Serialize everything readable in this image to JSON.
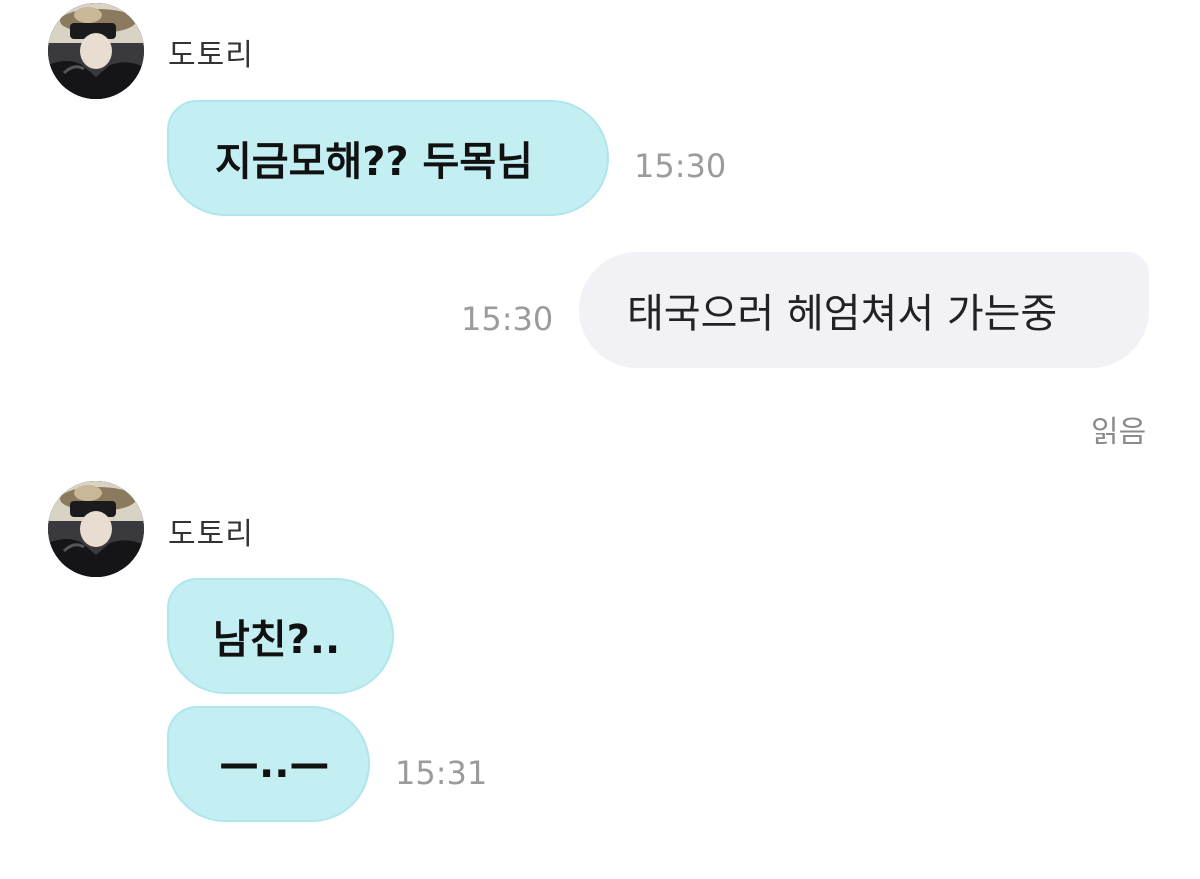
{
  "chat": {
    "group1": {
      "sender_name": "도토리",
      "avatar_icon": "profile-photo-icon",
      "bubble_text": "지금모해?? 두목님",
      "time": "15:30"
    },
    "outgoing": {
      "bubble_text": "태국으러 헤엄쳐서 가는중",
      "time": "15:30",
      "read_status": "읽음"
    },
    "group2": {
      "sender_name": "도토리",
      "avatar_icon": "profile-photo-icon",
      "bubble1_text": "남친?..",
      "bubble2_text": "—..—",
      "time": "15:31"
    }
  },
  "colors": {
    "incoming_bubble": "#c3eff3",
    "outgoing_bubble": "#f1f1f6",
    "timestamp": "#9b9b9b"
  }
}
